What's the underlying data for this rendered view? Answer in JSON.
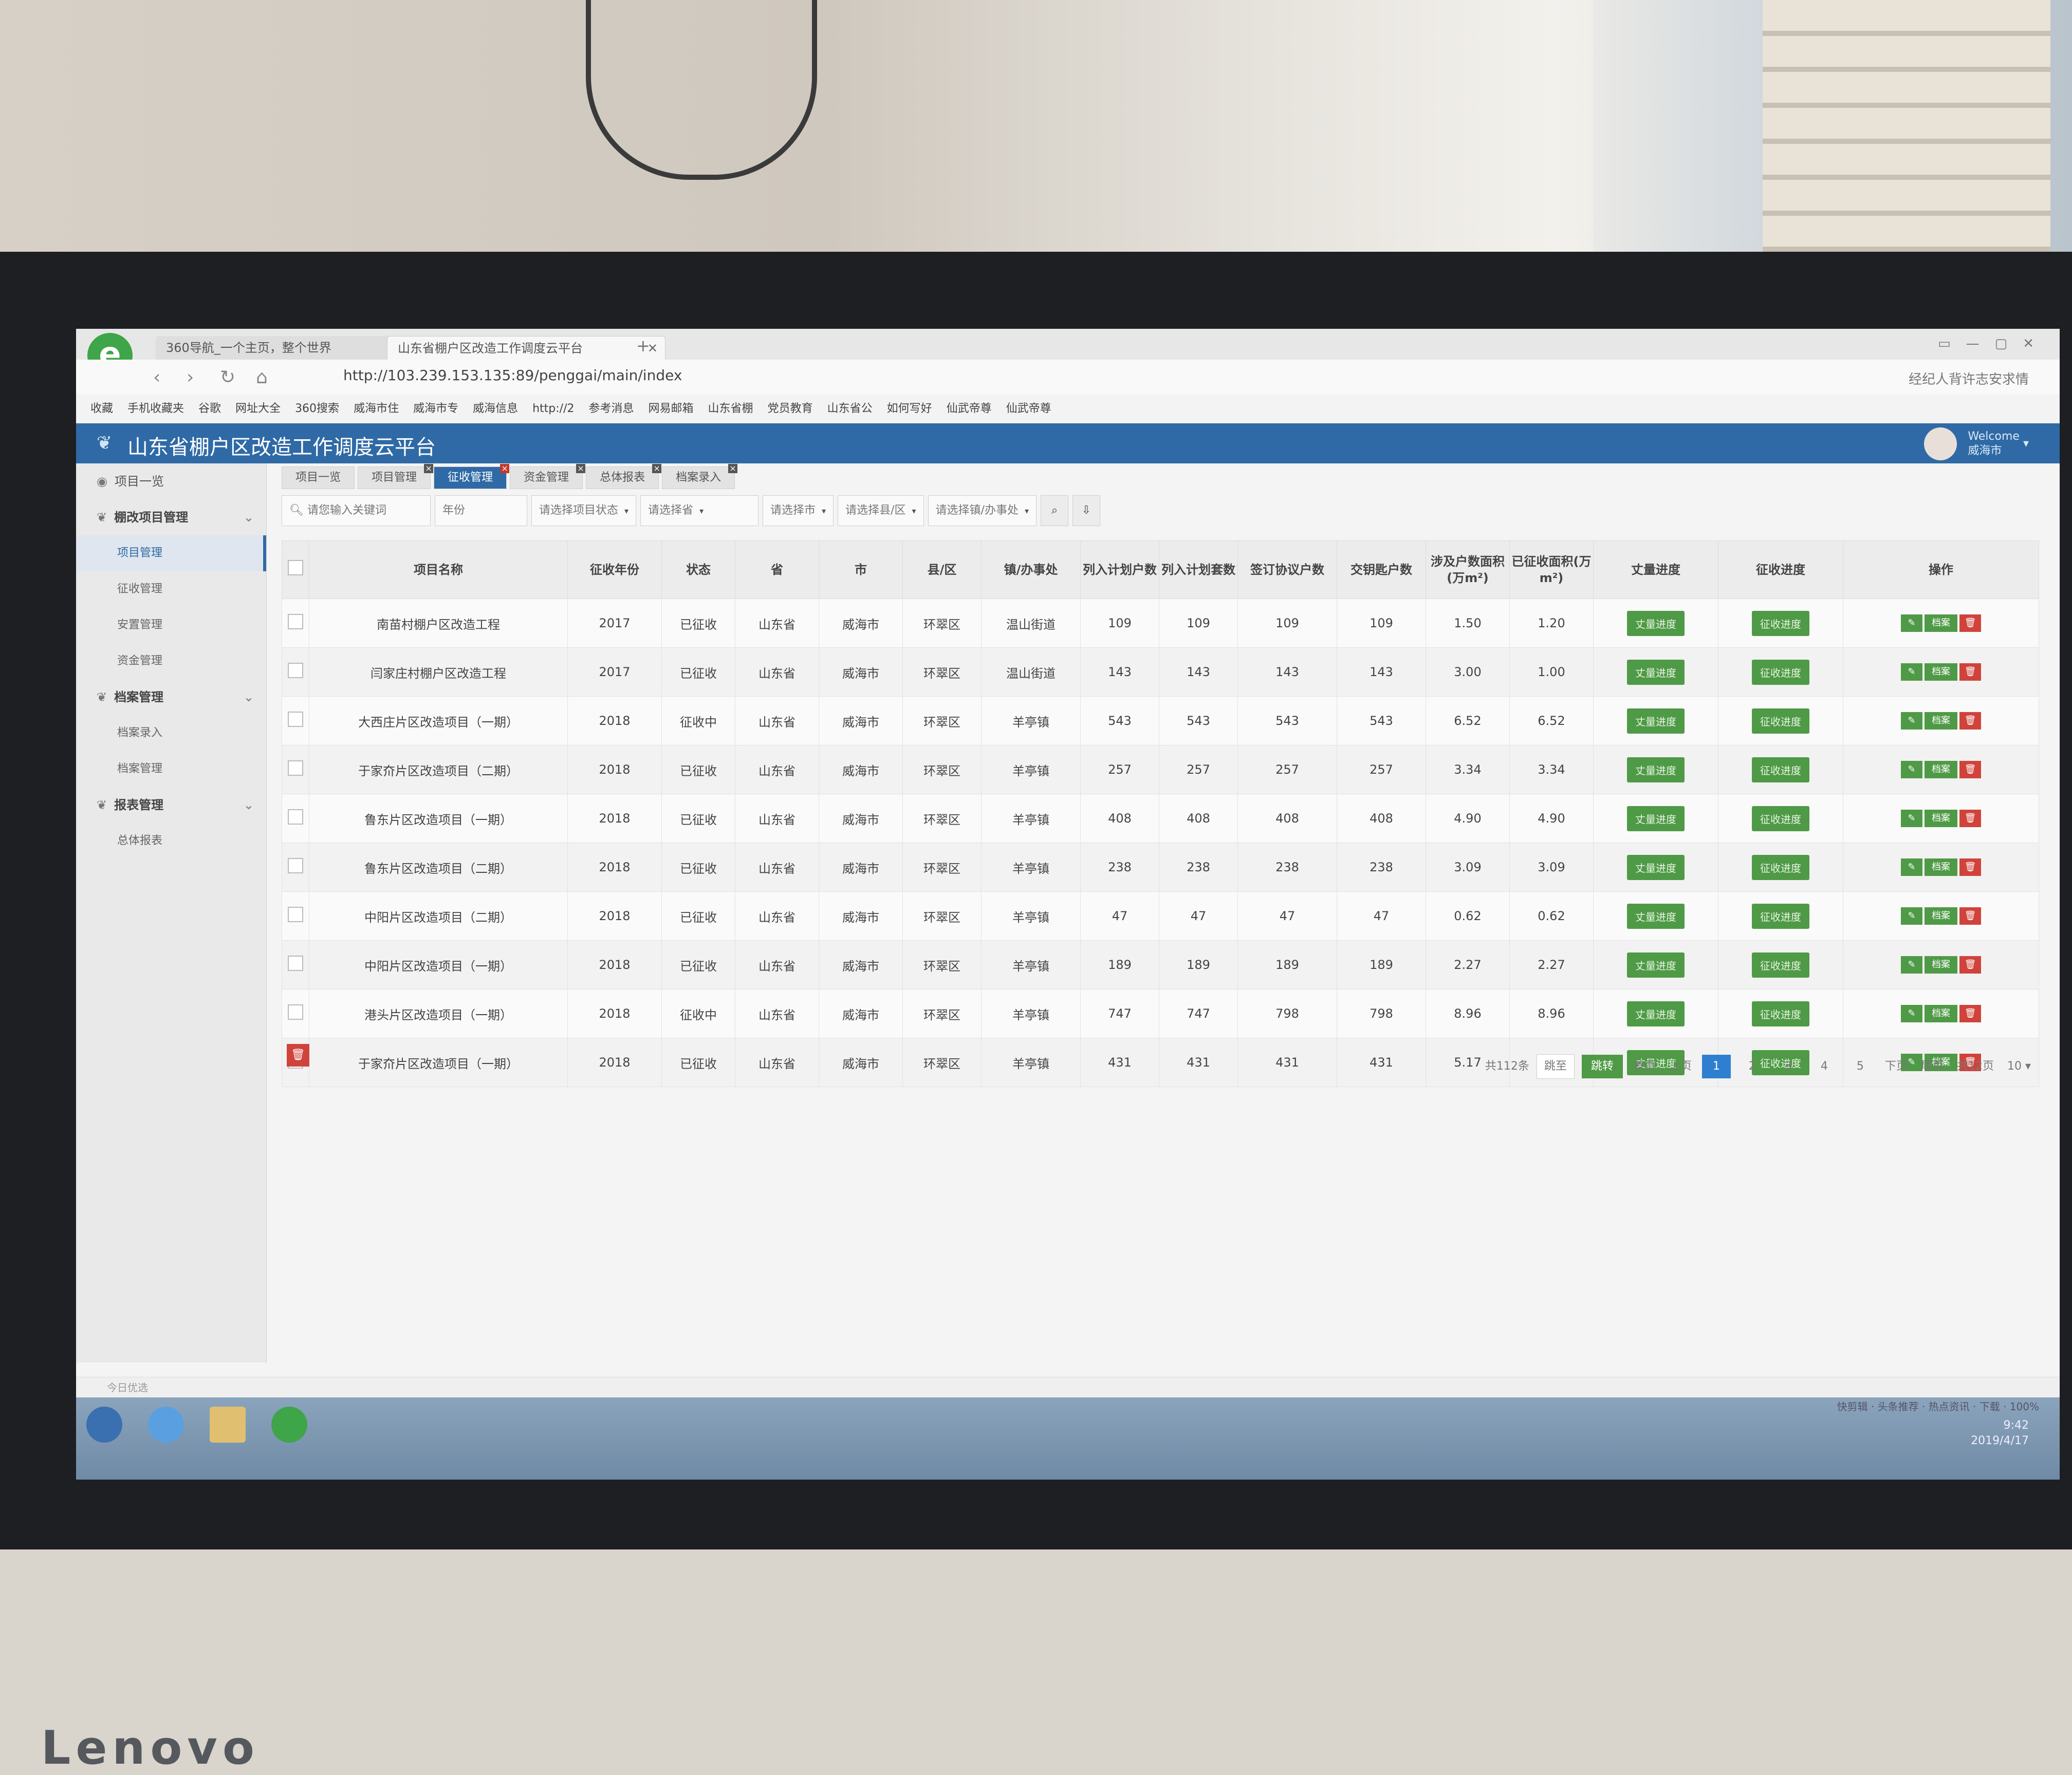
{
  "browser": {
    "tabs": [
      {
        "label": "360导航_一个主页，整个世界"
      },
      {
        "label": "山东省棚户区改造工作调度云平台"
      }
    ],
    "url": "http://103.239.153.135:89/penggai/main/index",
    "nav_right_text": "经纪人背许志安求情",
    "bookmarks": [
      "收藏",
      "手机收藏夹",
      "谷歌",
      "网址大全",
      "360搜索",
      "威海市住",
      "威海市专",
      "威海信息",
      "http://2",
      "参考消息",
      "网易邮箱",
      "山东省棚",
      "党员教育",
      "山东省公",
      "如何写好",
      "仙武帝尊",
      "仙武帝尊"
    ]
  },
  "app": {
    "title": "山东省棚户区改造工作调度云平台",
    "user_greeting": "Welcome",
    "user_name": "威海市"
  },
  "sidebar": {
    "items": [
      {
        "label": "项目一览",
        "type": "top"
      },
      {
        "label": "棚改项目管理",
        "type": "group"
      },
      {
        "label": "项目管理",
        "type": "sub",
        "active": true
      },
      {
        "label": "征收管理",
        "type": "sub"
      },
      {
        "label": "安置管理",
        "type": "sub"
      },
      {
        "label": "资金管理",
        "type": "sub"
      },
      {
        "label": "档案管理",
        "type": "group"
      },
      {
        "label": "档案录入",
        "type": "sub"
      },
      {
        "label": "档案管理",
        "type": "sub"
      },
      {
        "label": "报表管理",
        "type": "group"
      },
      {
        "label": "总体报表",
        "type": "sub"
      }
    ]
  },
  "content_tabs": [
    "项目一览",
    "项目管理",
    "征收管理",
    "资金管理",
    "总体报表",
    "档案录入"
  ],
  "active_tab": "征收管理",
  "filters": {
    "search_placeholder": "请您输入关键词",
    "year_placeholder": "年份",
    "status": "请选择项目状态",
    "province": "请选择省",
    "city": "请选择市",
    "county": "请选择县/区",
    "town": "请选择镇/办事处"
  },
  "table": {
    "headers": [
      "项目名称",
      "征收年份",
      "状态",
      "省",
      "市",
      "县/区",
      "镇/办事处",
      "列入计划户数",
      "列入计划套数",
      "签订协议户数",
      "交钥匙户数",
      "涉及户数面积(万m²)",
      "已征收面积(万m²)",
      "丈量进度",
      "征收进度",
      "操作"
    ],
    "measure_btn": "丈量进度",
    "collect_btn": "征收进度",
    "archive_btn": "档案",
    "rows": [
      [
        "南苗村棚户区改造工程",
        "2017",
        "已征收",
        "山东省",
        "威海市",
        "环翠区",
        "温山街道",
        "109",
        "109",
        "109",
        "109",
        "1.50",
        "1.20"
      ],
      [
        "闫家庄村棚户区改造工程",
        "2017",
        "已征收",
        "山东省",
        "威海市",
        "环翠区",
        "温山街道",
        "143",
        "143",
        "143",
        "143",
        "3.00",
        "1.00"
      ],
      [
        "大西庄片区改造项目（一期）",
        "2018",
        "征收中",
        "山东省",
        "威海市",
        "环翠区",
        "羊亭镇",
        "543",
        "543",
        "543",
        "543",
        "6.52",
        "6.52"
      ],
      [
        "于家夼片区改造项目（二期）",
        "2018",
        "已征收",
        "山东省",
        "威海市",
        "环翠区",
        "羊亭镇",
        "257",
        "257",
        "257",
        "257",
        "3.34",
        "3.34"
      ],
      [
        "鲁东片区改造项目（一期）",
        "2018",
        "已征收",
        "山东省",
        "威海市",
        "环翠区",
        "羊亭镇",
        "408",
        "408",
        "408",
        "408",
        "4.90",
        "4.90"
      ],
      [
        "鲁东片区改造项目（二期）",
        "2018",
        "已征收",
        "山东省",
        "威海市",
        "环翠区",
        "羊亭镇",
        "238",
        "238",
        "238",
        "238",
        "3.09",
        "3.09"
      ],
      [
        "中阳片区改造项目（二期）",
        "2018",
        "已征收",
        "山东省",
        "威海市",
        "环翠区",
        "羊亭镇",
        "47",
        "47",
        "47",
        "47",
        "0.62",
        "0.62"
      ],
      [
        "中阳片区改造项目（一期）",
        "2018",
        "已征收",
        "山东省",
        "威海市",
        "环翠区",
        "羊亭镇",
        "189",
        "189",
        "189",
        "189",
        "2.27",
        "2.27"
      ],
      [
        "港头片区改造项目（一期）",
        "2018",
        "征收中",
        "山东省",
        "威海市",
        "环翠区",
        "羊亭镇",
        "747",
        "747",
        "798",
        "798",
        "8.96",
        "8.96"
      ],
      [
        "于家夼片区改造项目（一期）",
        "2018",
        "已征收",
        "山东省",
        "威海市",
        "环翠区",
        "羊亭镇",
        "431",
        "431",
        "431",
        "431",
        "5.17",
        "5.17"
      ]
    ]
  },
  "pager": {
    "total": "共112条",
    "jump_placeholder": "跳至",
    "go": "跳转",
    "first": "首页",
    "prev": "上页",
    "pages": [
      "1",
      "2",
      "3",
      "4",
      "5"
    ],
    "current": "1",
    "next": "下页",
    "last": "尾页",
    "total_pages": "共12页",
    "page_size": "10"
  },
  "footer_text": "今日优选",
  "taskbar": {
    "time": "9:42",
    "date": "2019/4/17",
    "status_items": [
      "快剪辑",
      "头条推荐",
      "热点资讯",
      "下载",
      "100%"
    ]
  },
  "monitor_brand": "Lenovo",
  "colors": {
    "header_blue": "#2f6aa6",
    "btn_green": "#4f9a46",
    "delete_red": "#d0433b",
    "page_active": "#2f7fd0"
  }
}
